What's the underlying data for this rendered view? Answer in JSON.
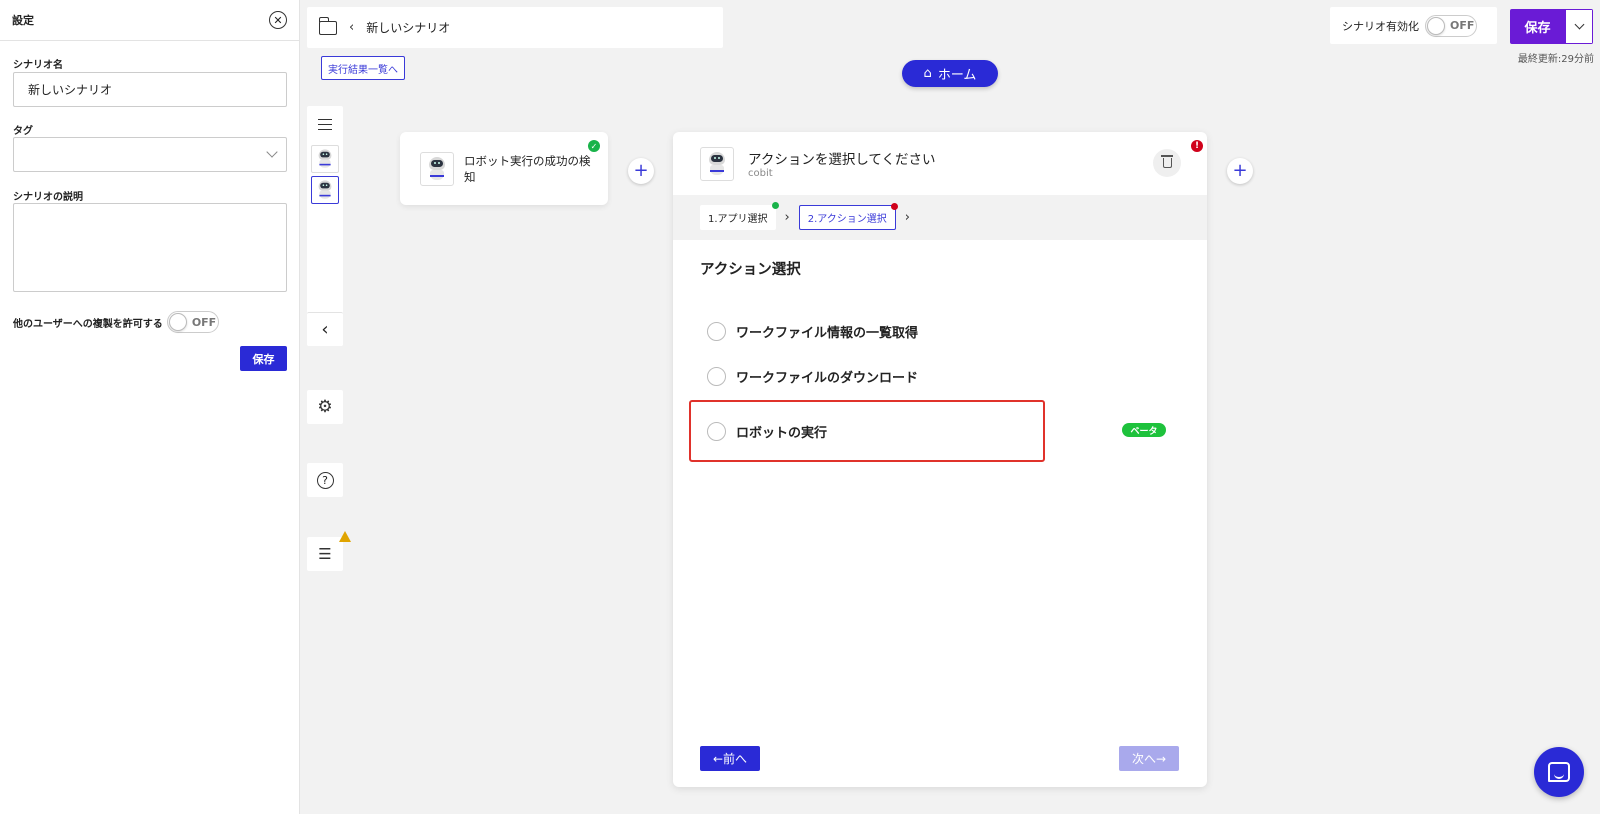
{
  "settings": {
    "title": "設定",
    "close_glyph": "✕",
    "name_label": "シナリオ名",
    "name_value": "新しいシナリオ",
    "tag_label": "タグ",
    "desc_label": "シナリオの説明",
    "copy_label": "他のユーザーへの複製を許可する",
    "copy_toggle": "OFF",
    "save_label": "保存"
  },
  "topbar": {
    "back_glyph": "‹",
    "scenario_name": "新しいシナリオ",
    "results_link": "実行結果一覧へ",
    "home_label": "ホーム",
    "home_glyph": "⌂",
    "activate_label": "シナリオ有効化",
    "activate_toggle": "OFF",
    "save_label": "保存",
    "last_updated": "最終更新:29分前"
  },
  "collapse_glyph": "‹",
  "settings_glyph": "⚙",
  "help_glyph": "?",
  "log_glyph": "☰",
  "trigger": {
    "text": "ロボット実行の成功の検知",
    "check_glyph": "✓"
  },
  "plus_glyph": "+",
  "action": {
    "title": "アクションを選択してください",
    "subtitle": "cobit",
    "error_glyph": "!",
    "steps": [
      {
        "label": "1.アプリ選択",
        "status_color": "#19b34a"
      },
      {
        "label": "2.アクション選択",
        "status_color": "#d0021b"
      }
    ],
    "step_chev": "›",
    "section_title": "アクション選択",
    "options": [
      "ワークファイル情報の一覧取得",
      "ワークファイルのダウンロード",
      "ロボットの実行"
    ],
    "beta_label": "ベータ",
    "prev_label": "←前へ",
    "next_label": "次へ→"
  },
  "colors": {
    "primary": "#2a2ad6",
    "save_purple": "#6a1bd6",
    "highlight_red": "#e0322b",
    "beta_green": "#1ec23c"
  }
}
